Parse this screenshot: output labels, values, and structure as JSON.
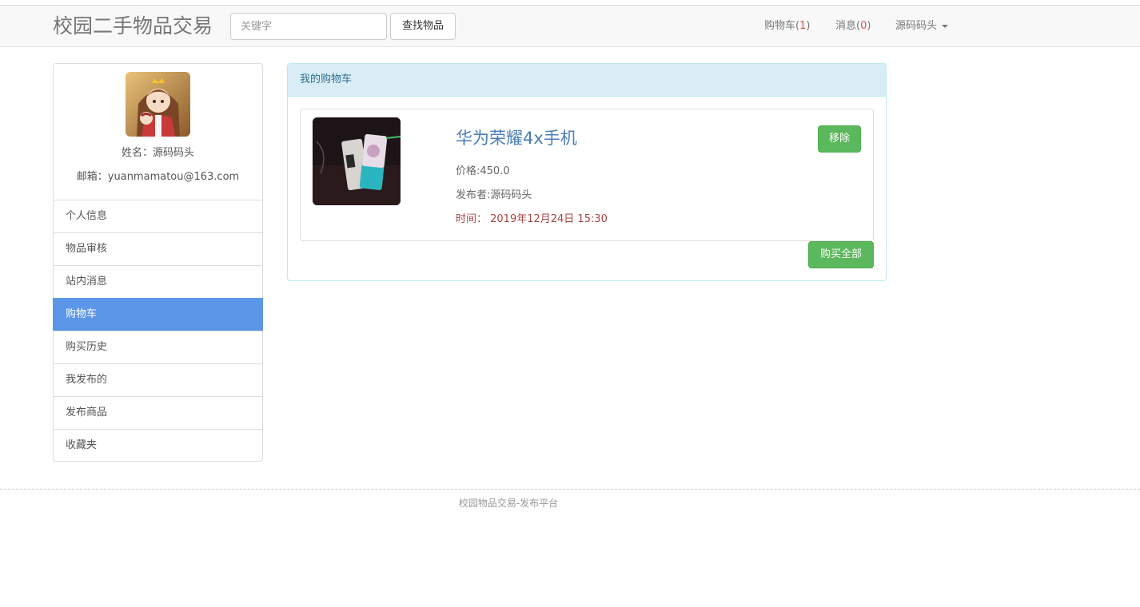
{
  "navbar": {
    "brand": "校园二手物品交易",
    "search_placeholder": "关键字",
    "search_button": "查找物品",
    "cart_label": "购物车(",
    "cart_count": "1",
    "msg_label": "消息(",
    "msg_count": "0",
    "close_paren": ")",
    "user_name": "源码码头"
  },
  "profile": {
    "name_line": "姓名：源码码头",
    "email_line": "邮箱：yuanmamatou@163.com"
  },
  "sidebar": {
    "items": [
      {
        "label": "个人信息",
        "active": false
      },
      {
        "label": "物品审核",
        "active": false
      },
      {
        "label": "站内消息",
        "active": false
      },
      {
        "label": "购物车",
        "active": true
      },
      {
        "label": "购买历史",
        "active": false
      },
      {
        "label": "我发布的",
        "active": false
      },
      {
        "label": "发布商品",
        "active": false
      },
      {
        "label": "收藏夹",
        "active": false
      }
    ]
  },
  "cart": {
    "heading": "我的购物车",
    "item": {
      "title": "华为荣耀4x手机",
      "price": "价格:450.0",
      "seller": "发布者:源码码头",
      "time": "时间：  2019年12月24日 15:30",
      "remove_label": "移除"
    },
    "buy_all_label": "购买全部"
  },
  "footer": {
    "text": "校园物品交易-发布平台"
  },
  "colors": {
    "active_menu": "#5b96e8",
    "success": "#5cb85c",
    "panel_heading": "#d9edf7",
    "title_link": "#4a7db5",
    "time_text": "#a94442"
  }
}
